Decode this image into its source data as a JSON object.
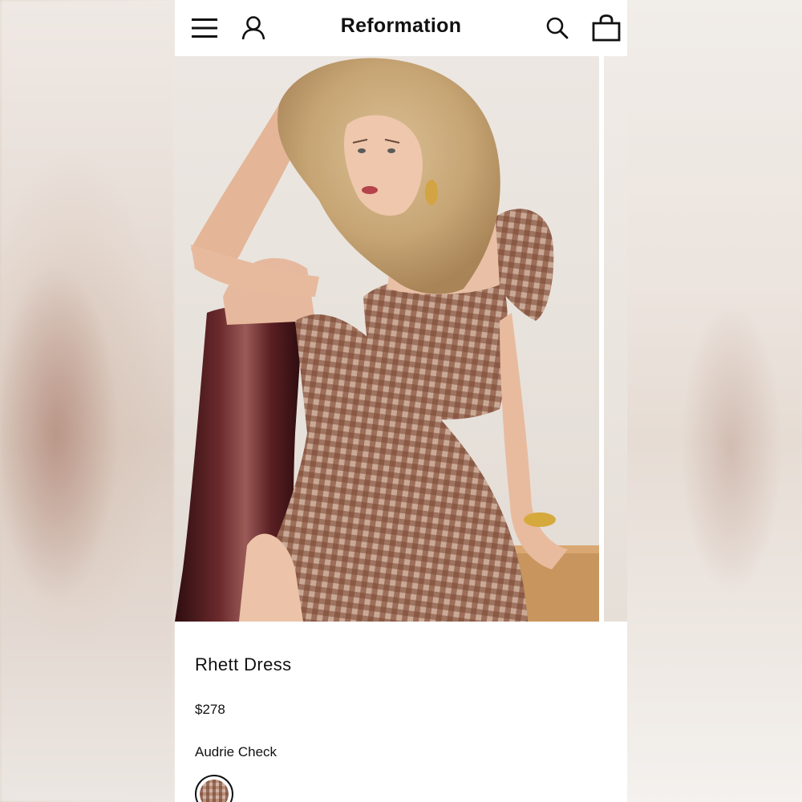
{
  "header": {
    "brand": "Reformation",
    "icons": [
      "menu-icon",
      "account-icon",
      "search-icon",
      "bag-icon"
    ]
  },
  "product": {
    "name": "Rhett Dress",
    "price": "$278",
    "color_name": "Audrie Check",
    "swatch_colors": [
      "#b88d74",
      "#6e3c2d",
      "#e1cdc8"
    ]
  },
  "colors": {
    "text": "#111111",
    "background": "#ffffff",
    "boot": "#4a1a1c",
    "dress": "#a87a63"
  }
}
